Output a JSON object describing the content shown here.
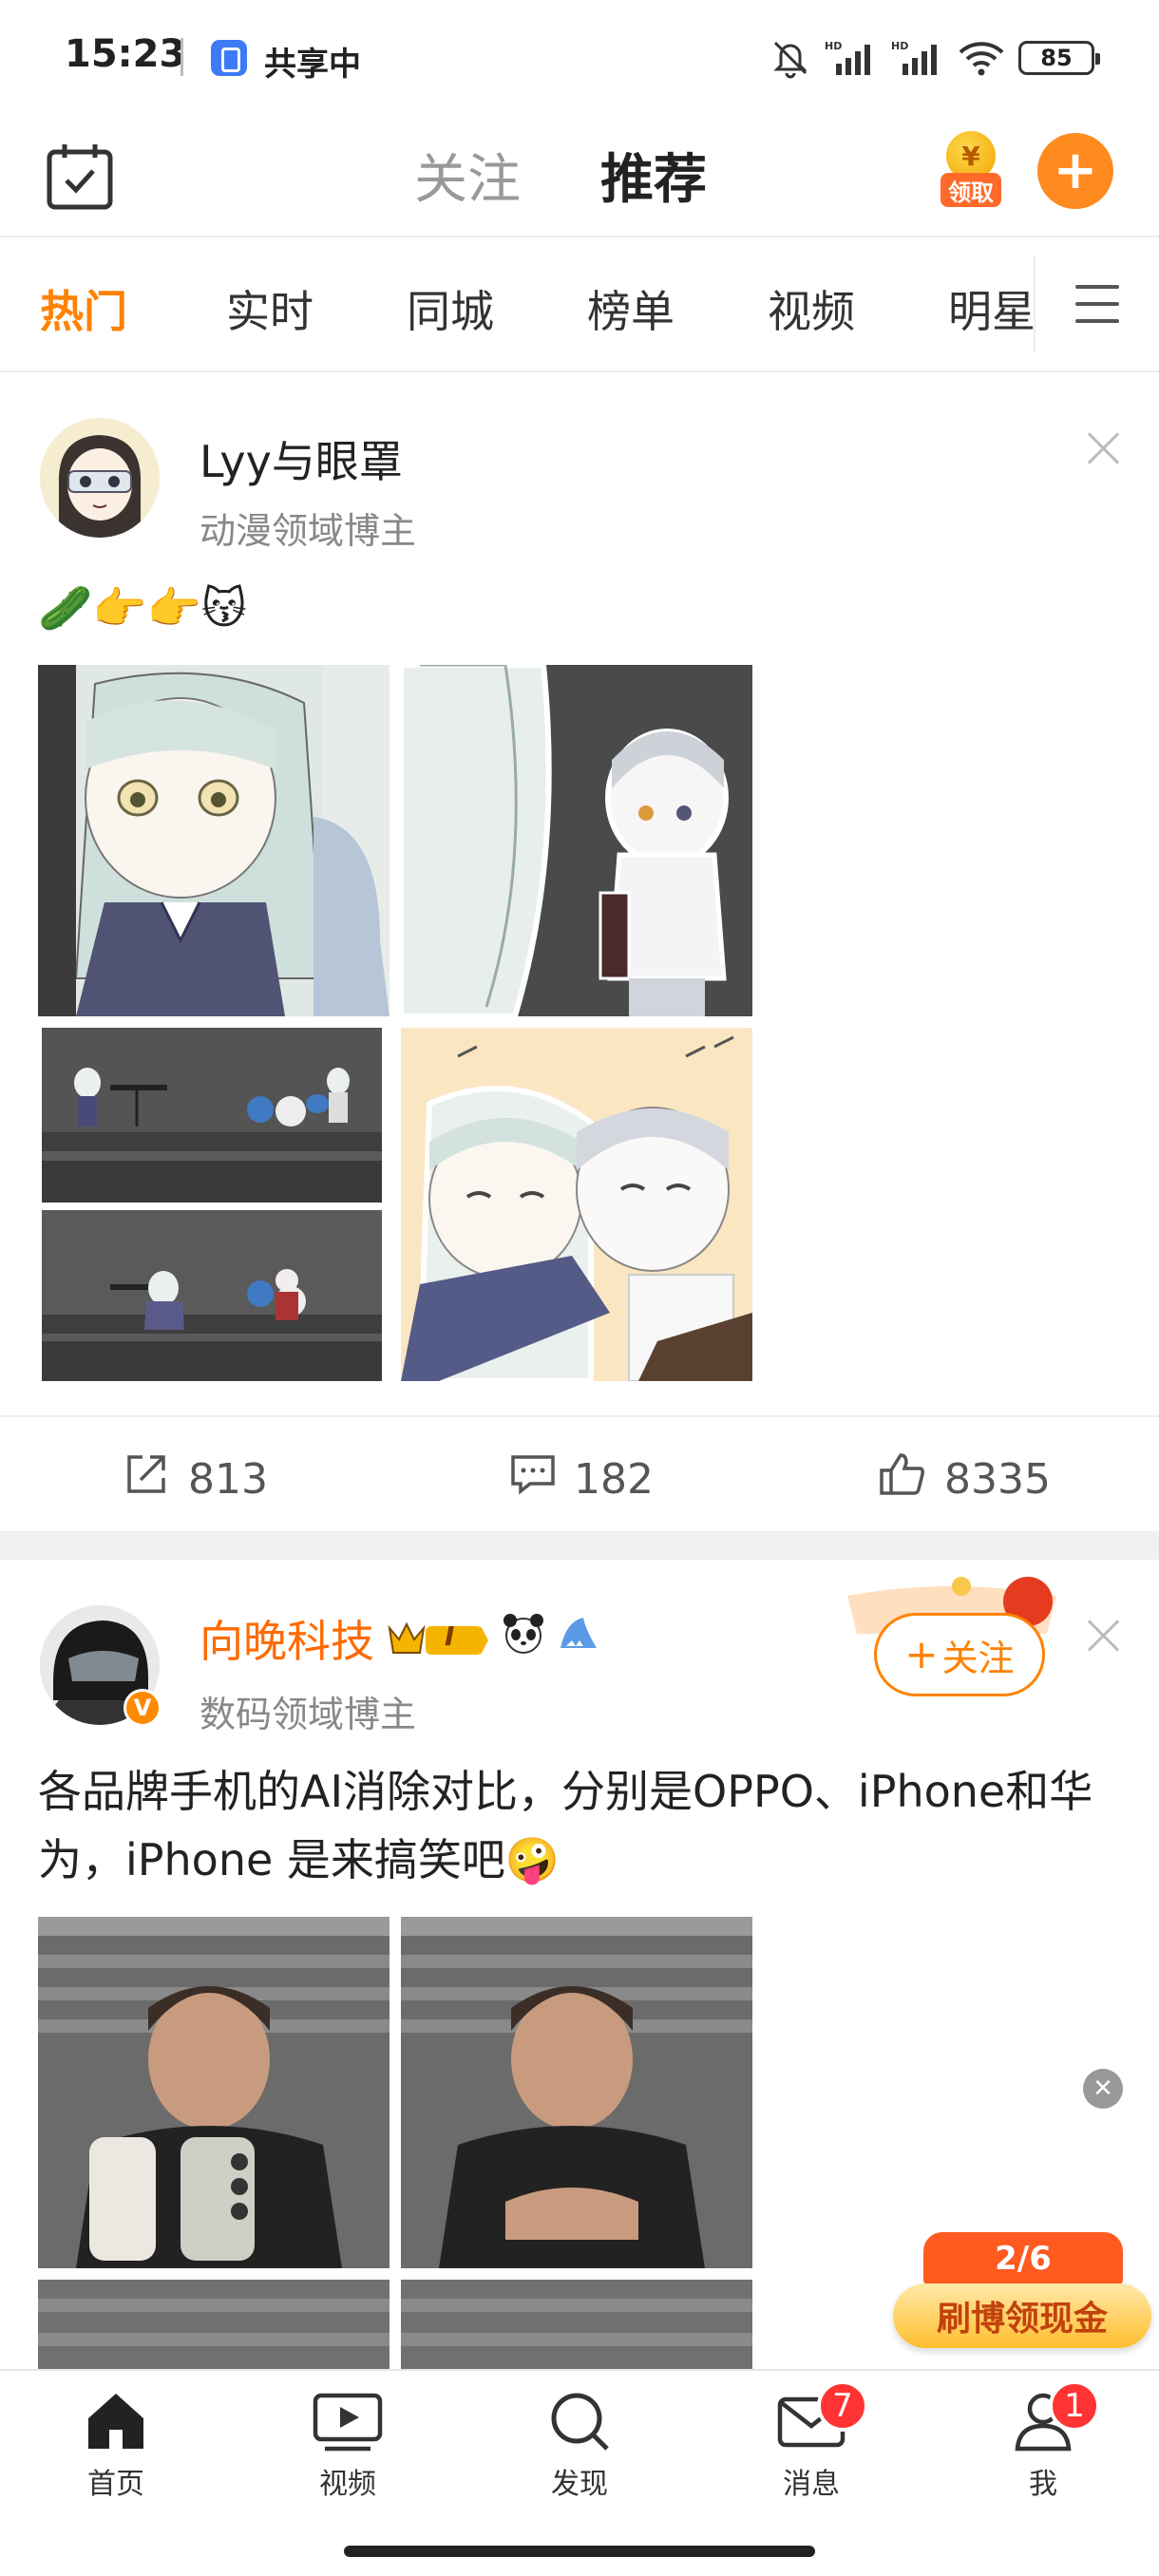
{
  "status_bar": {
    "time": "15:23",
    "share_label": "共享中",
    "battery": "85"
  },
  "top_nav": {
    "tabs": [
      "关注",
      "推荐"
    ],
    "active_tab": "推荐",
    "coin_label": "领取",
    "coin_symbol": "¥"
  },
  "channels": {
    "items": [
      "热门",
      "实时",
      "同城",
      "榜单",
      "视频",
      "明星"
    ],
    "active": "热门"
  },
  "posts": [
    {
      "author": "Lyy与眼罩",
      "subtitle": "动漫领域博主",
      "text": "🥒👉👉😽",
      "images": [
        "anime-illustration-1",
        "anime-illustration-2",
        "anime-stage-scene-1",
        "anime-hug-illustration",
        "anime-stage-scene-2"
      ],
      "repost_count": "813",
      "comment_count": "182",
      "like_count": "8335"
    },
    {
      "author": "向晚科技",
      "subtitle": "数码领域博主",
      "text": "各品牌手机的AI消除对比，分别是OPPO、iPhone和华为，iPhone 是来搞笑吧🤪",
      "follow_label": "关注",
      "vip_badge": "I",
      "images": [
        "man-holding-phones",
        "man-photo-edited",
        "man-photo-3",
        "man-photo-4"
      ]
    }
  ],
  "floating": {
    "progress": "2/6",
    "cash_label": "刷博领现金"
  },
  "tabbar": {
    "items": [
      {
        "label": "首页",
        "icon": "home-icon"
      },
      {
        "label": "视频",
        "icon": "video-icon"
      },
      {
        "label": "发现",
        "icon": "search-icon"
      },
      {
        "label": "消息",
        "icon": "mail-icon",
        "badge": "7"
      },
      {
        "label": "我",
        "icon": "profile-icon",
        "badge": "1"
      }
    ]
  },
  "colors": {
    "accent": "#ff8200",
    "author_highlight": "#ff6a00",
    "badge_red": "#ff3333"
  }
}
